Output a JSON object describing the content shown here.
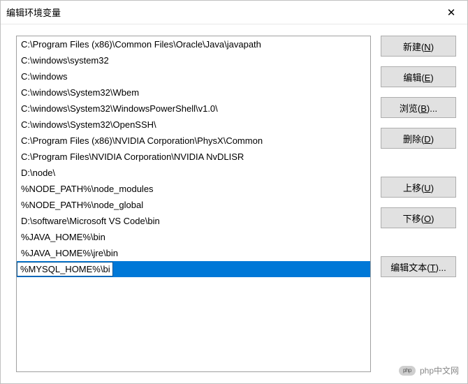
{
  "window": {
    "title": "编辑环境变量"
  },
  "paths": [
    "C:\\Program Files (x86)\\Common Files\\Oracle\\Java\\javapath",
    "C:\\windows\\system32",
    "C:\\windows",
    "C:\\windows\\System32\\Wbem",
    "C:\\windows\\System32\\WindowsPowerShell\\v1.0\\",
    "C:\\windows\\System32\\OpenSSH\\",
    "C:\\Program Files (x86)\\NVIDIA Corporation\\PhysX\\Common",
    "C:\\Program Files\\NVIDIA Corporation\\NVIDIA NvDLISR",
    "D:\\node\\",
    "%NODE_PATH%\\node_modules",
    "%NODE_PATH%\\node_global",
    "D:\\software\\Microsoft VS Code\\bin",
    "%JAVA_HOME%\\bin",
    "%JAVA_HOME%\\jre\\bin"
  ],
  "editing_value": "%MYSQL_HOME%\\bin",
  "buttons": {
    "new_": "新建(",
    "new_m": "N",
    "new_end": ")",
    "edit_": "编辑(",
    "edit_m": "E",
    "edit_end": ")",
    "browse_": "浏览(",
    "browse_m": "B",
    "browse_end": ")...",
    "delete_": "删除(",
    "delete_m": "D",
    "delete_end": ")",
    "moveup_": "上移(",
    "moveup_m": "U",
    "moveup_end": ")",
    "movedown_": "下移(",
    "movedown_m": "O",
    "movedown_end": ")",
    "edittext_": "编辑文本(",
    "edittext_m": "T",
    "edittext_end": ")..."
  },
  "watermark": "php中文网"
}
